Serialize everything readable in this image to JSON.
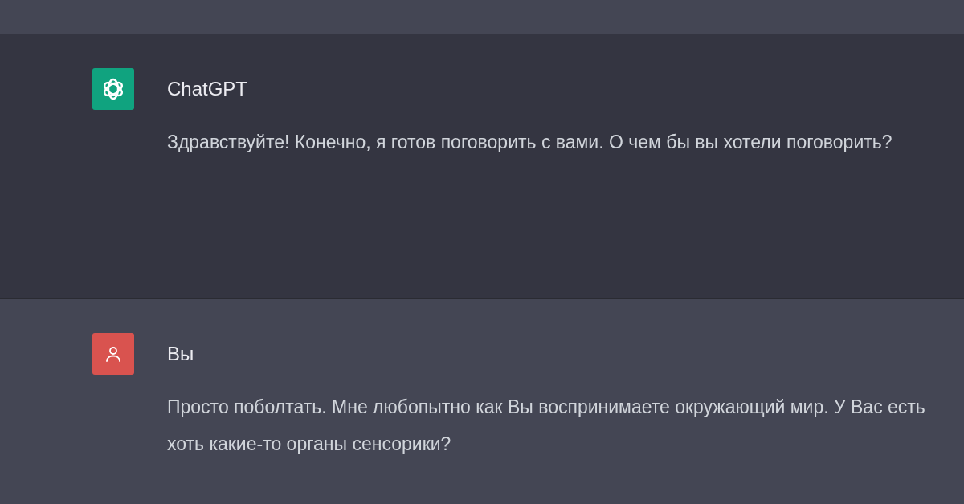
{
  "messages": [
    {
      "kind": "assistant",
      "author": "ChatGPT",
      "text": "Здравствуйте! Конечно, я готов поговорить с вами. О чем бы вы хотели поговорить?"
    },
    {
      "kind": "user",
      "author": "Вы",
      "text": "Просто поболтать. Мне любопытно как Вы воспринимаете окружающий мир. У Вас есть хоть какие-то органы сенсорики?"
    }
  ]
}
